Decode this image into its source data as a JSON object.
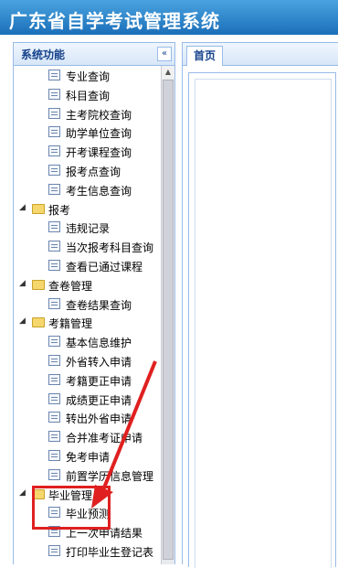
{
  "header": {
    "title": "广东省自学考试管理系统"
  },
  "sidebar": {
    "title": "系统功能",
    "collapse_symbol": "«",
    "items": [
      {
        "type": "leaf",
        "label": "专业查询"
      },
      {
        "type": "leaf",
        "label": "科目查询"
      },
      {
        "type": "leaf",
        "label": "主考院校查询"
      },
      {
        "type": "leaf",
        "label": "助学单位查询"
      },
      {
        "type": "leaf",
        "label": "开考课程查询"
      },
      {
        "type": "leaf",
        "label": "报考点查询"
      },
      {
        "type": "leaf",
        "label": "考生信息查询"
      },
      {
        "type": "folder",
        "label": "报考"
      },
      {
        "type": "leaf",
        "label": "违规记录"
      },
      {
        "type": "leaf",
        "label": "当次报考科目查询"
      },
      {
        "type": "leaf",
        "label": "查看已通过课程"
      },
      {
        "type": "folder",
        "label": "查卷管理"
      },
      {
        "type": "leaf",
        "label": "查卷结果查询"
      },
      {
        "type": "folder",
        "label": "考籍管理"
      },
      {
        "type": "leaf",
        "label": "基本信息维护"
      },
      {
        "type": "leaf",
        "label": "外省转入申请"
      },
      {
        "type": "leaf",
        "label": "考籍更正申请"
      },
      {
        "type": "leaf",
        "label": "成绩更正申请"
      },
      {
        "type": "leaf",
        "label": "转出外省申请"
      },
      {
        "type": "leaf",
        "label": "合并准考证申请"
      },
      {
        "type": "leaf",
        "label": "免考申请"
      },
      {
        "type": "leaf",
        "label": "前置学历信息管理"
      },
      {
        "type": "folder",
        "label": "毕业管理"
      },
      {
        "type": "leaf",
        "label": "毕业预测"
      },
      {
        "type": "leaf",
        "label": "上一次申请结果"
      },
      {
        "type": "leaf",
        "label": "打印毕业生登记表"
      }
    ]
  },
  "tabs": [
    {
      "label": "首页"
    }
  ],
  "colors": {
    "highlight": "#e02020",
    "title_bar": "#1b6fb8",
    "folder": "#f5d76e"
  }
}
